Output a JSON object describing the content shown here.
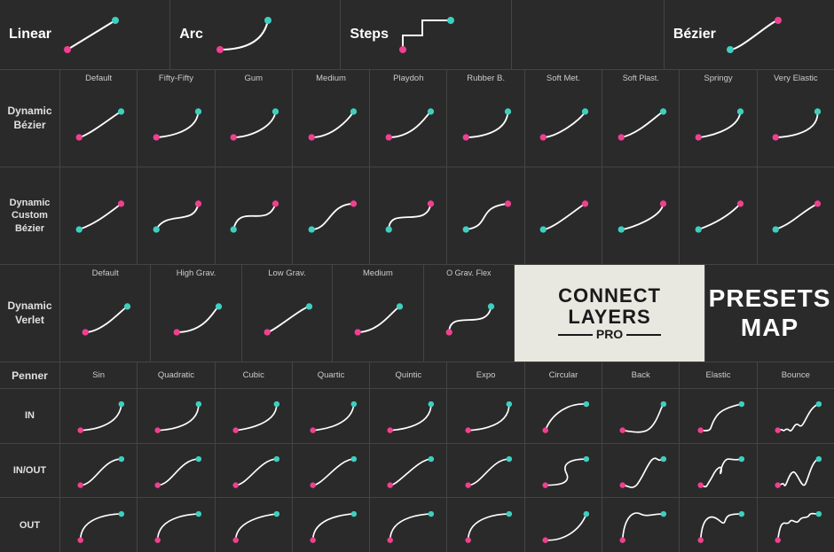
{
  "rows": {
    "linear": {
      "label": "Linear",
      "variants": [
        {
          "id": "linear-main",
          "label": "",
          "curve": "linear"
        }
      ]
    },
    "arc": {
      "label": "Arc",
      "variants": [
        {
          "id": "arc-main",
          "label": "",
          "curve": "arc"
        }
      ]
    },
    "steps": {
      "label": "Steps",
      "variants": [
        {
          "id": "steps-main",
          "label": "",
          "curve": "steps"
        }
      ]
    },
    "bezier": {
      "label": "Bézier",
      "variants": [
        {
          "id": "bezier-main",
          "label": "",
          "curve": "bezier-simple"
        }
      ]
    },
    "dynamic_bezier": {
      "label": "Dynamic Bézier",
      "presets": [
        "Default",
        "Fifty-Fifty",
        "Gum",
        "Medium",
        "Playdoh",
        "Rubber B.",
        "Soft Met.",
        "Soft Plast.",
        "Springy",
        "Very Elastic"
      ]
    },
    "dynamic_custom_bezier": {
      "label": "Dynamic Custom Bézier",
      "presets": [
        "",
        "",
        "",
        "",
        "",
        "",
        "",
        "",
        "",
        ""
      ]
    },
    "dynamic_verlet": {
      "label": "Dynamic Verlet",
      "presets": [
        "Default",
        "High Grav.",
        "Low Grav.",
        "Medium",
        "O Grav. Flex"
      ]
    },
    "penner": {
      "label": "Penner",
      "columns": [
        "Sin",
        "Quadratic",
        "Cubic",
        "Quartic",
        "Quintic",
        "Expo",
        "Circular",
        "Back",
        "Elastic",
        "Bounce"
      ],
      "rows": [
        "IN",
        "IN/OUT",
        "OUT"
      ]
    }
  },
  "connect_layers": {
    "line1": "CONNECT",
    "line2": "LAYERS",
    "line3": "PRO"
  },
  "presets_map": {
    "line1": "PRESETS",
    "line2": "MAP"
  }
}
